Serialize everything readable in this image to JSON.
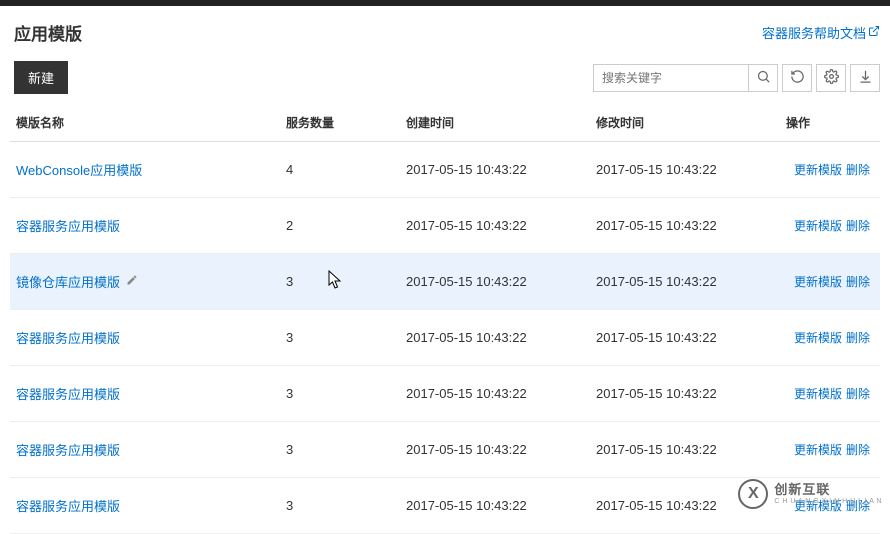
{
  "header": {
    "title": "应用模版",
    "help_link": "容器服务帮助文档"
  },
  "toolbar": {
    "new_label": "新建",
    "search_placeholder": "搜索关键字"
  },
  "table": {
    "columns": {
      "name": "模版名称",
      "svc": "服务数量",
      "created": "创建时间",
      "modified": "修改时间",
      "actions": "操作"
    },
    "actions": {
      "update": "更新模版",
      "delete": "删除"
    },
    "rows": [
      {
        "name": "WebConsole应用模版",
        "svc": "4",
        "created": "2017-05-15 10:43:22",
        "modified": "2017-05-15 10:43:22",
        "highlight": false,
        "edit": false
      },
      {
        "name": "容器服务应用模版",
        "svc": "2",
        "created": "2017-05-15 10:43:22",
        "modified": "2017-05-15 10:43:22",
        "highlight": false,
        "edit": false
      },
      {
        "name": "镜像仓库应用模版",
        "svc": "3",
        "created": "2017-05-15 10:43:22",
        "modified": "2017-05-15 10:43:22",
        "highlight": true,
        "edit": true
      },
      {
        "name": "容器服务应用模版",
        "svc": "3",
        "created": "2017-05-15 10:43:22",
        "modified": "2017-05-15 10:43:22",
        "highlight": false,
        "edit": false
      },
      {
        "name": "容器服务应用模版",
        "svc": "3",
        "created": "2017-05-15 10:43:22",
        "modified": "2017-05-15 10:43:22",
        "highlight": false,
        "edit": false
      },
      {
        "name": "容器服务应用模版",
        "svc": "3",
        "created": "2017-05-15 10:43:22",
        "modified": "2017-05-15 10:43:22",
        "highlight": false,
        "edit": false
      },
      {
        "name": "容器服务应用模版",
        "svc": "3",
        "created": "2017-05-15 10:43:22",
        "modified": "2017-05-15 10:43:22",
        "highlight": false,
        "edit": false
      }
    ]
  },
  "watermark": {
    "cn": "创新互联",
    "en": "C H U A N G X I N H U L I A N"
  }
}
